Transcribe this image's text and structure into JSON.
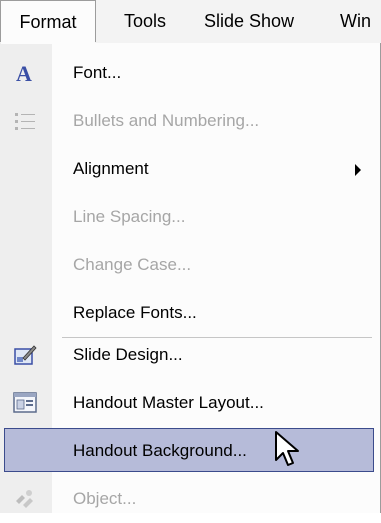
{
  "menubar": {
    "items": [
      {
        "label": "Format"
      },
      {
        "label": "Tools"
      },
      {
        "label": "Slide Show"
      },
      {
        "label": "Win"
      }
    ]
  },
  "format_menu": {
    "items": [
      {
        "label": "Font...",
        "icon": "font-A-icon",
        "enabled": true
      },
      {
        "label": "Bullets and Numbering...",
        "icon": "bullets-icon",
        "enabled": false
      },
      {
        "label": "Alignment",
        "enabled": true,
        "submenu": true
      },
      {
        "label": "Line Spacing...",
        "enabled": false
      },
      {
        "label": "Change Case...",
        "enabled": false
      },
      {
        "label": "Replace Fonts...",
        "enabled": true
      },
      {
        "label": "Slide Design...",
        "icon": "slide-design-icon",
        "enabled": true
      },
      {
        "label": "Handout Master Layout...",
        "icon": "master-layout-icon",
        "enabled": true
      },
      {
        "label": "Handout Background...",
        "enabled": true,
        "selected": true
      },
      {
        "label": "Object...",
        "icon": "object-icon",
        "enabled": false
      }
    ]
  },
  "colors": {
    "highlight_fill": "#b6bbd9",
    "highlight_border": "#3b4b8c",
    "disabled_text": "#a6a6a6",
    "icon_blue": "#3a4fa5"
  }
}
